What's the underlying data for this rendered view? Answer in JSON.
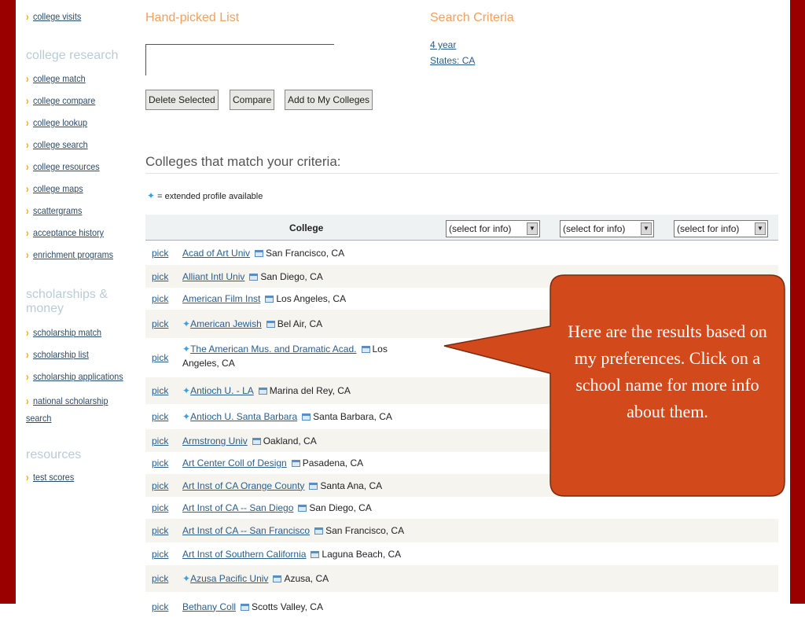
{
  "sidebar": {
    "top_item": "college visits",
    "sections": [
      {
        "title": "college research",
        "items": [
          "college match",
          "college compare",
          "college lookup",
          "college search",
          "college resources",
          "college maps",
          "scattergrams",
          "acceptance history",
          "enrichment programs"
        ]
      },
      {
        "title": "scholarships & money",
        "items": [
          "scholarship match",
          "scholarship list",
          "scholarship applications",
          "national scholarship search"
        ]
      },
      {
        "title": "resources",
        "items": [
          "test scores"
        ]
      }
    ]
  },
  "handpicked": {
    "title": "Hand-picked List",
    "buttons": {
      "delete": "Delete Selected",
      "compare": "Compare",
      "add": "Add to My Colleges"
    }
  },
  "criteria": {
    "title": "Search Criteria",
    "items": [
      "4 year",
      "States: CA"
    ]
  },
  "results": {
    "title": "Colleges that match your criteria:",
    "legend": "= extended profile available",
    "column": "College",
    "select_value": "(select for info)",
    "pick_label": "pick",
    "rows": [
      {
        "name": "Acad of Art Univ",
        "location": "San Francisco, CA",
        "extended": false
      },
      {
        "name": "Alliant Intl Univ",
        "location": "San Diego, CA",
        "extended": false
      },
      {
        "name": "American Film Inst",
        "location": "Los Angeles, CA",
        "extended": false
      },
      {
        "name": "American Jewish",
        "location": "Bel Air, CA",
        "extended": true
      },
      {
        "name": "The American Mus. and Dramatic Acad.",
        "location": "Los Angeles, CA",
        "extended": true
      },
      {
        "name": "Antioch U. - LA",
        "location": "Marina del Rey, CA",
        "extended": true
      },
      {
        "name": "Antioch U. Santa Barbara",
        "location": "Santa Barbara, CA",
        "extended": true
      },
      {
        "name": "Armstrong Univ",
        "location": "Oakland, CA",
        "extended": false
      },
      {
        "name": "Art Center Coll of Design",
        "location": "Pasadena, CA",
        "extended": false
      },
      {
        "name": "Art Inst of CA Orange County",
        "location": "Santa Ana, CA",
        "extended": false
      },
      {
        "name": "Art Inst of CA -- San Diego",
        "location": "San Diego, CA",
        "extended": false
      },
      {
        "name": "Art Inst of CA -- San Francisco",
        "location": "San Francisco, CA",
        "extended": false
      },
      {
        "name": "Art Inst of Southern California",
        "location": "Laguna Beach, CA",
        "extended": false
      },
      {
        "name": "Azusa Pacific Univ",
        "location": "Azusa, CA",
        "extended": true
      },
      {
        "name": "Bethany Coll",
        "location": "Scotts Valley, CA",
        "extended": false
      }
    ]
  },
  "callout": {
    "text": "Here are the results based on my preferences. Click on a school name for more info about them.",
    "color": "#d2491c"
  }
}
